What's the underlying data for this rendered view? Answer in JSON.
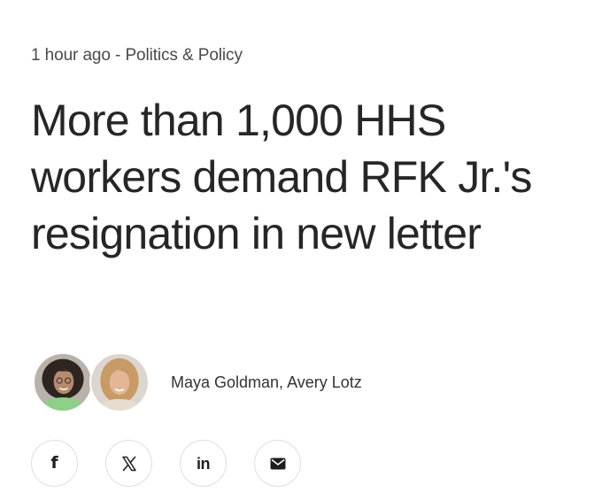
{
  "article": {
    "timestamp": "1 hour ago",
    "separator": " - ",
    "category": "Politics & Policy",
    "headline": "More than 1,000 HHS workers demand RFK Jr.'s resignation in new letter",
    "authors": "Maya Goldman, Avery Lotz"
  },
  "avatars": [
    {
      "icon": "author-photo-maya-goldman"
    },
    {
      "icon": "author-photo-avery-lotz"
    }
  ],
  "share": {
    "facebook": {
      "icon": "facebook-icon",
      "glyph": "f"
    },
    "x": {
      "icon": "x-icon",
      "glyph": "𝕏"
    },
    "linkedin": {
      "icon": "linkedin-icon",
      "glyph": "in"
    },
    "email": {
      "icon": "email-icon"
    }
  },
  "colors": {
    "text": "#262626",
    "meta": "#4a4a4a",
    "button_border": "#dedede"
  }
}
